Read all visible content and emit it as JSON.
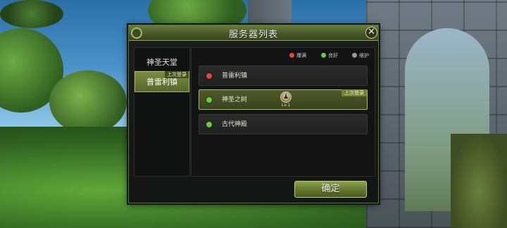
{
  "dialog": {
    "title": "服务器列表",
    "close_icon": "close-icon"
  },
  "categories": [
    {
      "label": "神圣天堂",
      "selected": false
    },
    {
      "label": "普雷利镇",
      "selected": true,
      "tag": "上次登录"
    }
  ],
  "legend": [
    {
      "label": "爆满",
      "color": "#e04a3a"
    },
    {
      "label": "良好",
      "color": "#6ccb3c"
    },
    {
      "label": "维护",
      "color": "#9a9a9a"
    }
  ],
  "servers": [
    {
      "name": "普雷利镇",
      "status_color": "#e04a3a",
      "selected": false
    },
    {
      "name": "神圣之树",
      "status_color": "#6ccb3c",
      "selected": true,
      "tag": "上次登录",
      "level": "Lv.1",
      "avatar_icon": "character-avatar-icon"
    },
    {
      "name": "古代神殿",
      "status_color": "#6ccb3c",
      "selected": false
    }
  ],
  "confirm_label": "确定"
}
